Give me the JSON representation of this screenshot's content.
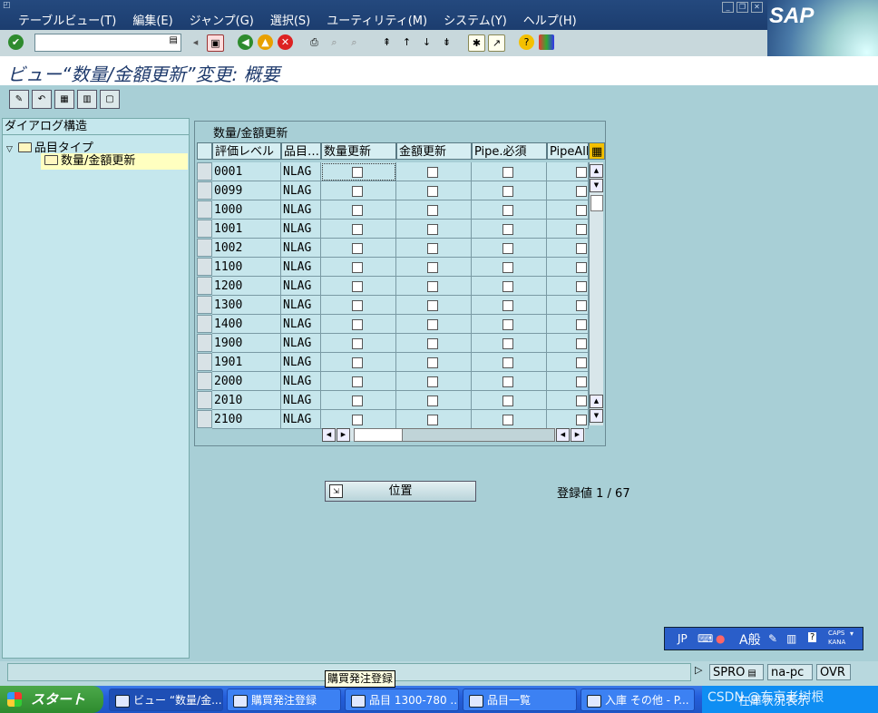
{
  "menubar": {
    "items": [
      "テーブルビュー(T)",
      "編集(E)",
      "ジャンプ(G)",
      "選択(S)",
      "ユーティリティ(M)",
      "システム(Y)",
      "ヘルプ(H)"
    ],
    "logo": "SAP"
  },
  "system_toolbar": {
    "command_field_value": "",
    "icons": [
      "enter-icon",
      "save-icon",
      "back-icon",
      "exit-icon",
      "cancel-icon",
      "print-icon",
      "find-icon",
      "find-next-icon",
      "first-page-icon",
      "previous-page-icon",
      "next-page-icon",
      "last-page-icon",
      "new-session-icon",
      "shortcut-icon",
      "help-icon",
      "layout-icon"
    ]
  },
  "title": "ビュー“数量/金額更新”変更: 概要",
  "application_toolbar": {
    "icons": [
      "display-change-icon",
      "undo-icon",
      "select-all-icon",
      "select-block-icon",
      "deselect-all-icon"
    ]
  },
  "tree": {
    "header": "ダイアログ構造",
    "nodes": [
      {
        "label": "品目タイプ",
        "level": 1,
        "expanded": true
      },
      {
        "label": "数量/金額更新",
        "level": 2,
        "selected": true
      }
    ]
  },
  "table": {
    "caption": "数量/金額更新",
    "columns": [
      "評価レベル",
      "品目…",
      "数量更新",
      "金額更新",
      "Pipe.必須",
      "PipeAllo"
    ],
    "rows": [
      {
        "level": "0001",
        "type": "NLAG"
      },
      {
        "level": "0099",
        "type": "NLAG"
      },
      {
        "level": "1000",
        "type": "NLAG"
      },
      {
        "level": "1001",
        "type": "NLAG"
      },
      {
        "level": "1002",
        "type": "NLAG"
      },
      {
        "level": "1100",
        "type": "NLAG"
      },
      {
        "level": "1200",
        "type": "NLAG"
      },
      {
        "level": "1300",
        "type": "NLAG"
      },
      {
        "level": "1400",
        "type": "NLAG"
      },
      {
        "level": "1900",
        "type": "NLAG"
      },
      {
        "level": "1901",
        "type": "NLAG"
      },
      {
        "level": "2000",
        "type": "NLAG"
      },
      {
        "level": "2010",
        "type": "NLAG"
      },
      {
        "level": "2100",
        "type": "NLAG"
      }
    ]
  },
  "position_button": "位置",
  "entry_info": "登録値 1 / 67",
  "ime_bar": {
    "lang": "JP",
    "mode": "A般",
    "caps": "CAPS",
    "kana": "KANA"
  },
  "status_bar": {
    "transaction": "SPRO",
    "server": "na-pc",
    "mode": "OVR"
  },
  "tooltip": "購買発注登録",
  "taskbar": {
    "start": "スタート",
    "tasks": [
      "ビュー “数量/金...",
      "購買発注登録",
      "品目 1300-780 ...",
      "品目一覧",
      "入庫 その他 - P...",
      "在庫状況表示"
    ],
    "watermark": "CSDN @东京老树根"
  }
}
